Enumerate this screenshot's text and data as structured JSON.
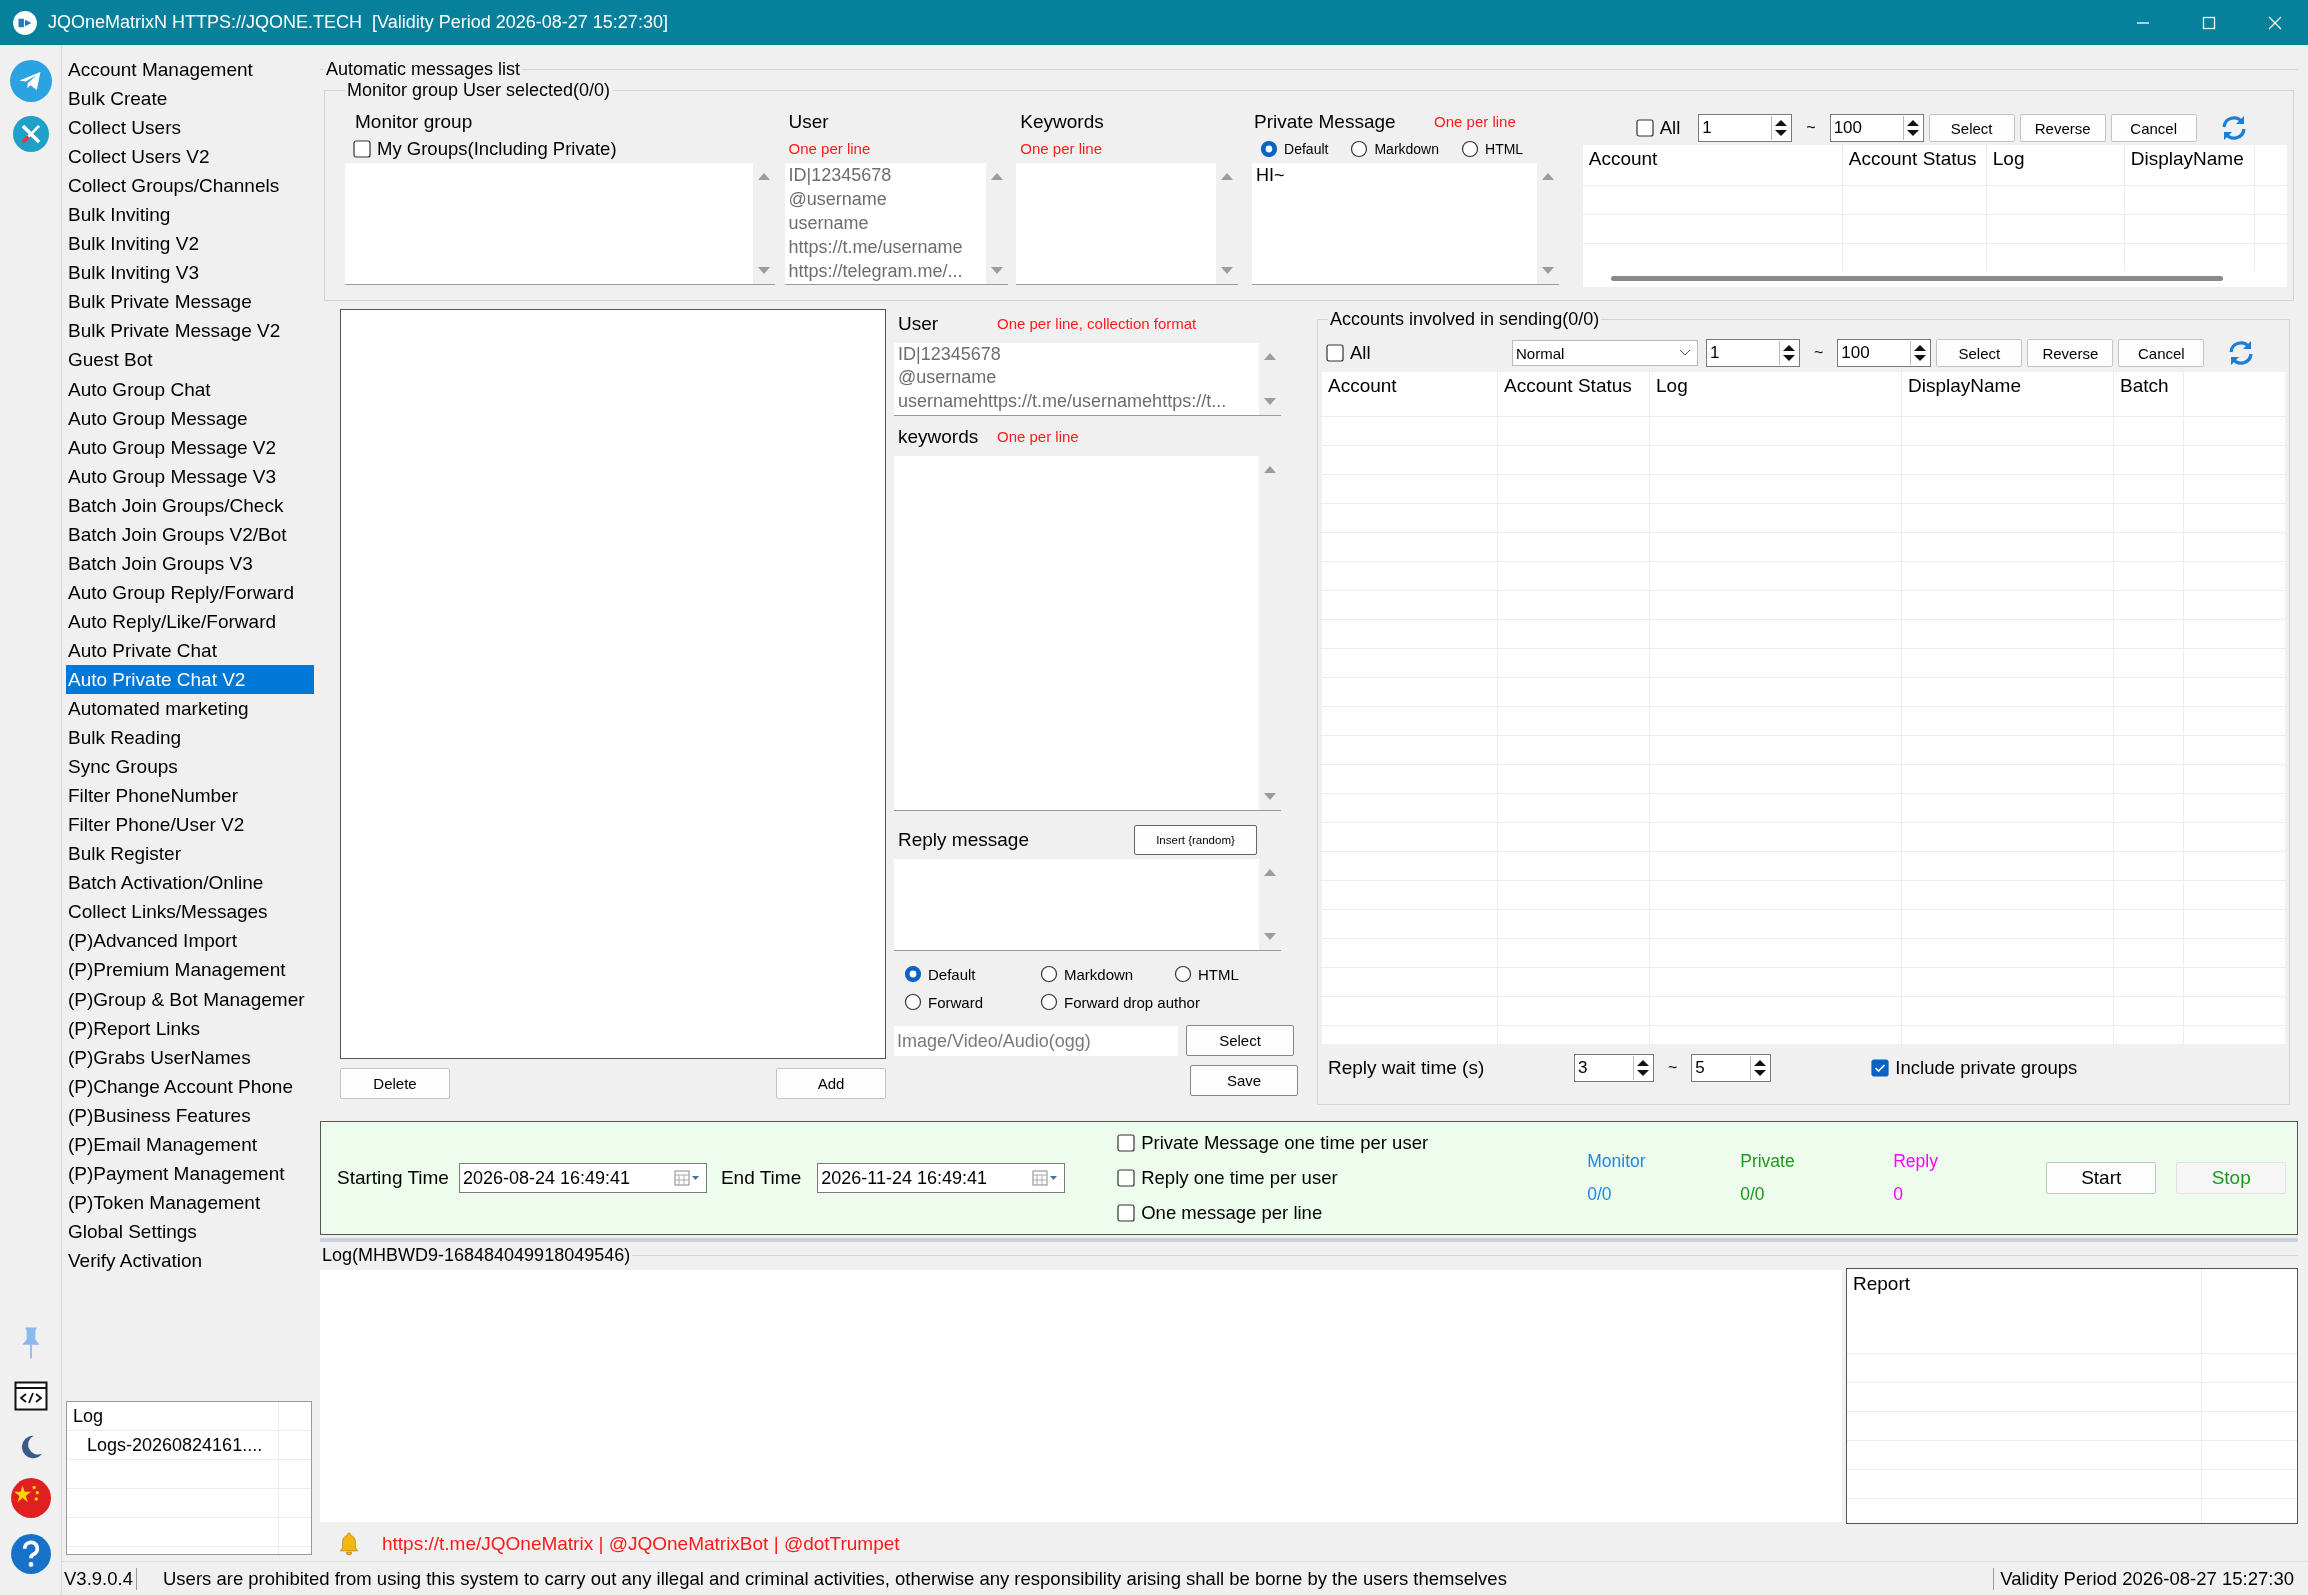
{
  "window": {
    "title": "JQOneMatrixN HTTPS://JQONE.TECH  [Validity Period 2026-08-27 15:27:30]"
  },
  "sidebar": {
    "items": [
      {
        "label": "Account Management",
        "selected": false
      },
      {
        "label": "Bulk Create",
        "selected": false
      },
      {
        "label": "Collect Users",
        "selected": false
      },
      {
        "label": "Collect Users V2",
        "selected": false
      },
      {
        "label": "Collect Groups/Channels",
        "selected": false
      },
      {
        "label": "Bulk Inviting",
        "selected": false
      },
      {
        "label": "Bulk Inviting V2",
        "selected": false
      },
      {
        "label": "Bulk Inviting V3",
        "selected": false
      },
      {
        "label": "Bulk Private Message",
        "selected": false
      },
      {
        "label": "Bulk Private Message V2",
        "selected": false
      },
      {
        "label": "Guest Bot",
        "selected": false
      },
      {
        "label": "Auto Group Chat",
        "selected": false
      },
      {
        "label": "Auto Group Message",
        "selected": false
      },
      {
        "label": "Auto Group Message V2",
        "selected": false
      },
      {
        "label": "Auto Group Message V3",
        "selected": false
      },
      {
        "label": "Batch Join Groups/Check",
        "selected": false
      },
      {
        "label": "Batch Join Groups V2/Bot",
        "selected": false
      },
      {
        "label": "Batch Join Groups V3",
        "selected": false
      },
      {
        "label": "Auto Group Reply/Forward",
        "selected": false
      },
      {
        "label": "Auto Reply/Like/Forward",
        "selected": false
      },
      {
        "label": "Auto Private Chat",
        "selected": false
      },
      {
        "label": "Auto Private Chat V2",
        "selected": true
      },
      {
        "label": "Automated marketing",
        "selected": false
      },
      {
        "label": "Bulk Reading",
        "selected": false
      },
      {
        "label": "Sync Groups",
        "selected": false
      },
      {
        "label": "Filter PhoneNumber",
        "selected": false
      },
      {
        "label": "Filter Phone/User V2",
        "selected": false
      },
      {
        "label": "Bulk Register",
        "selected": false
      },
      {
        "label": "Batch Activation/Online",
        "selected": false
      },
      {
        "label": "Collect Links/Messages",
        "selected": false
      },
      {
        "label": "(P)Advanced Import",
        "selected": false
      },
      {
        "label": "(P)Premium Management",
        "selected": false
      },
      {
        "label": "(P)Group & Bot Managemer",
        "selected": false
      },
      {
        "label": "(P)Report Links",
        "selected": false
      },
      {
        "label": "(P)Grabs UserNames",
        "selected": false
      },
      {
        "label": "(P)Change Account Phone",
        "selected": false
      },
      {
        "label": "(P)Business Features",
        "selected": false
      },
      {
        "label": "(P)Email Management",
        "selected": false
      },
      {
        "label": "(P)Payment Management",
        "selected": false
      },
      {
        "label": "(P)Token Management",
        "selected": false
      },
      {
        "label": "Global Settings",
        "selected": false
      },
      {
        "label": "Verify Activation",
        "selected": false
      }
    ]
  },
  "sidebar_log": {
    "title": "Log",
    "items": [
      "Logs-20260824161...."
    ]
  },
  "automatic_messages": {
    "title": "Automatic messages list"
  },
  "monitor": {
    "title": "Monitor group User selected(0/0)",
    "group": {
      "label": "Monitor group",
      "my_groups": {
        "label": "My Groups(Including Private)",
        "checked": false
      }
    },
    "user": {
      "label": "User",
      "hint": "One per line",
      "placeholder": "ID|12345678\n@username\nusername\nhttps://t.me/username\nhttps://telegram.me/..."
    },
    "keywords": {
      "label": "Keywords",
      "hint": "One per line"
    },
    "private_message": {
      "label": "Private Message",
      "hint": "One per line",
      "value": "HI~",
      "formats": [
        {
          "label": "Default",
          "selected": true
        },
        {
          "label": "Markdown",
          "selected": false
        },
        {
          "label": "HTML",
          "selected": false
        }
      ]
    },
    "selection": {
      "all": {
        "label": "All",
        "checked": false
      },
      "from": "1",
      "separator": "~",
      "to": "100",
      "buttons": [
        "Select",
        "Reverse",
        "Cancel"
      ]
    },
    "table": {
      "columns": [
        "Account",
        "Account Status",
        "Log",
        "DisplayName"
      ]
    }
  },
  "groups_list": {
    "buttons": [
      "Delete",
      "Add"
    ]
  },
  "reply": {
    "user": {
      "label": "User",
      "hint": "One per line, collection format",
      "placeholder": "ID|12345678\n@username\nusernamehttps://t.me/usernamehttps://t..."
    },
    "keywords": {
      "label": "keywords",
      "hint": "One per line"
    },
    "reply_message": {
      "label": "Reply message",
      "insert_button": "Insert {random}"
    },
    "formats": [
      {
        "label": "Default",
        "selected": true
      },
      {
        "label": "Markdown",
        "selected": false
      },
      {
        "label": "HTML",
        "selected": false
      },
      {
        "label": "Forward",
        "selected": false
      },
      {
        "label": "Forward drop author",
        "selected": false
      }
    ],
    "media": {
      "placeholder": "Image/Video/Audio(ogg)",
      "button": "Select"
    },
    "save_button": "Save"
  },
  "sending": {
    "title": "Accounts involved in sending(0/0)",
    "all": {
      "label": "All",
      "checked": false
    },
    "mode": "Normal",
    "from": "1",
    "separator": "~",
    "to": "100",
    "buttons": [
      "Select",
      "Reverse",
      "Cancel"
    ],
    "table": {
      "columns": [
        "Account",
        "Account Status",
        "Log",
        "DisplayName",
        "Batch"
      ]
    },
    "wait": {
      "label": "Reply wait time (s)",
      "from": "3",
      "separator": "~",
      "to": "5"
    },
    "include_private": {
      "label": "Include private groups",
      "checked": true
    }
  },
  "schedule": {
    "start": {
      "label": "Starting Time",
      "value": "2026-08-24 16:49:41"
    },
    "end": {
      "label": "End Time",
      "value": "2026-11-24 16:49:41"
    },
    "options": [
      {
        "label": "Private Message one time per user",
        "checked": false
      },
      {
        "label": "Reply one time per user",
        "checked": false
      },
      {
        "label": "One message per line",
        "checked": false
      }
    ],
    "stats": [
      {
        "label": "Monitor",
        "value": "0/0",
        "color": "#1e88e5"
      },
      {
        "label": "Private",
        "value": "0/0",
        "color": "#1a9a1a"
      },
      {
        "label": "Reply",
        "value": "0",
        "color": "#ff00ff"
      }
    ],
    "buttons": [
      {
        "label": "Start",
        "disabled": false,
        "color": "#000000"
      },
      {
        "label": "Stop",
        "disabled": true,
        "color": "#1a9a1a"
      }
    ]
  },
  "log": {
    "title": "Log(MHBWD9-168484049918049546)",
    "report": {
      "columns": [
        "Report"
      ]
    },
    "links": "https://t.me/JQOneMatrix | @JQOneMatrixBot | @dotTrumpet"
  },
  "status_bar": {
    "version": "V3.9.0.4",
    "notice": "Users are prohibited from using this system to carry out any illegal and criminal activities, otherwise any responsibility arising shall be borne by the users themselves",
    "validity": "Validity Period 2026-08-27 15:27:30"
  }
}
